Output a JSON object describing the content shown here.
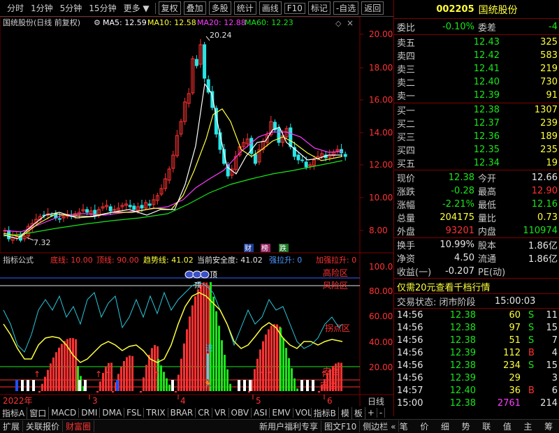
{
  "toolbar": {
    "items": [
      "分时",
      "1分钟",
      "5分钟",
      "15分钟",
      "更多"
    ],
    "buttons": [
      "复权",
      "叠加",
      "多股",
      "统计",
      "画线",
      "F10",
      "标记",
      "-自选",
      "返回"
    ]
  },
  "kline": {
    "title": "国统股份(日线 前复权)",
    "ma5": "MA5: 12.59",
    "ma10": "MA10: 12.58",
    "ma20": "MA20: 12.88",
    "ma60": "MA60: 12.23",
    "high_label": "20.24",
    "low_label": "7.32",
    "y_ticks": [
      "20.00",
      "18.00",
      "16.00",
      "14.00",
      "12.00",
      "10.00",
      "8.00"
    ],
    "badges": [
      "财",
      "榜",
      "跌"
    ]
  },
  "indicator": {
    "name": "指标公式",
    "line_bottom": "底线: 10.00",
    "line_top": "顶线: 90.00",
    "trend": "趋势线: 41.02",
    "safety": "当前安全度: 41.02",
    "strong": "强拉升: 0",
    "accel": "加强拉升: 0",
    "y_ticks": [
      "100.0",
      "80.00",
      "60.00",
      "40.00",
      "20.00"
    ],
    "labels": [
      "高险区",
      "风险区",
      "拐点区",
      "安全",
      "安区"
    ],
    "top_marker": "顶",
    "enter_marker": "进"
  },
  "x_axis": {
    "labels": [
      "2022年",
      "3",
      "4",
      "5",
      "6"
    ],
    "right": "日线"
  },
  "bottom_tabs": [
    "指标A",
    "窗口",
    "MACD",
    "DMI",
    "DMA",
    "FSL",
    "TRIX",
    "BRAR",
    "CR",
    "VR",
    "OBV",
    "ASI",
    "EMV",
    "VOL-TDX",
    "指标B",
    "模",
    "板",
    "+",
    "-"
  ],
  "statusbar": [
    "扩展",
    "关联报价",
    "财富圈",
    "新用户福利专享",
    "图文F10",
    "侧边栏"
  ],
  "quote": {
    "code": "002205",
    "name": "国统股份",
    "weibi": "-0.10%",
    "weicha": "-4",
    "asks": [
      {
        "label": "卖五",
        "price": "12.43",
        "vol": "325"
      },
      {
        "label": "卖四",
        "price": "12.42",
        "vol": "583"
      },
      {
        "label": "卖三",
        "price": "12.41",
        "vol": "219"
      },
      {
        "label": "卖二",
        "price": "12.40",
        "vol": "730"
      },
      {
        "label": "卖一",
        "price": "12.39",
        "vol": "91"
      }
    ],
    "bids": [
      {
        "label": "买一",
        "price": "12.38",
        "vol": "1307"
      },
      {
        "label": "买二",
        "price": "12.37",
        "vol": "239"
      },
      {
        "label": "买三",
        "price": "12.36",
        "vol": "189"
      },
      {
        "label": "买四",
        "price": "12.35",
        "vol": "235"
      },
      {
        "label": "买五",
        "price": "12.34",
        "vol": "19"
      }
    ],
    "stats": [
      {
        "l1": "现价",
        "v1": "12.38",
        "c1": "green",
        "l2": "今开",
        "v2": "12.66",
        "c2": "white"
      },
      {
        "l1": "涨跌",
        "v1": "-0.28",
        "c1": "green",
        "l2": "最高",
        "v2": "12.90",
        "c2": "red"
      },
      {
        "l1": "涨幅",
        "v1": "-2.21%",
        "c1": "green",
        "l2": "最低",
        "v2": "12.16",
        "c2": "green"
      },
      {
        "l1": "总量",
        "v1": "204175",
        "c1": "yellow",
        "l2": "量比",
        "v2": "0.73",
        "c2": "yellow"
      },
      {
        "l1": "外盘",
        "v1": "93201",
        "c1": "red",
        "l2": "内盘",
        "v2": "110974",
        "c2": "green"
      }
    ],
    "stats2": [
      {
        "l1": "换手",
        "v1": "10.99%",
        "l2": "股本",
        "v2": "1.86亿"
      },
      {
        "l1": "净资",
        "v1": "4.50",
        "l2": "流通",
        "v2": "1.86亿"
      },
      {
        "l1": "收益(一)",
        "v1": "-0.207",
        "l2": "PE(动)",
        "v2": ""
      }
    ],
    "promo": "仅需20元查看千档行情",
    "trade_status": "交易状态: 闭市阶段",
    "trade_time": "15:00:03",
    "ticks": [
      {
        "t": "14:56",
        "p": "12.38",
        "pc": "green",
        "v": "60",
        "vc": "yellow",
        "bs": "S",
        "bsc": "green",
        "n": "11"
      },
      {
        "t": "14:56",
        "p": "12.38",
        "pc": "green",
        "v": "97",
        "vc": "yellow",
        "bs": "S",
        "bsc": "green",
        "n": "15"
      },
      {
        "t": "14:56",
        "p": "12.38",
        "pc": "green",
        "v": "51",
        "vc": "yellow",
        "bs": "S",
        "bsc": "green",
        "n": "7"
      },
      {
        "t": "14:56",
        "p": "12.39",
        "pc": "green",
        "v": "112",
        "vc": "yellow",
        "bs": "B",
        "bsc": "red",
        "n": "4"
      },
      {
        "t": "14:56",
        "p": "12.38",
        "pc": "green",
        "v": "234",
        "vc": "yellow",
        "bs": "S",
        "bsc": "green",
        "n": "15"
      },
      {
        "t": "14:56",
        "p": "12.39",
        "pc": "green",
        "v": "29",
        "vc": "yellow",
        "bs": "",
        "bsc": "green",
        "n": "3"
      },
      {
        "t": "14:57",
        "p": "12.40",
        "pc": "green",
        "v": "36",
        "vc": "yellow",
        "bs": "B",
        "bsc": "red",
        "n": "6"
      },
      {
        "t": "15:00",
        "p": "12.38",
        "pc": "green",
        "v": "2761",
        "vc": "magenta",
        "bs": "",
        "bsc": "green",
        "n": "214"
      }
    ],
    "tabs": [
      "笔",
      "价",
      "细",
      "势",
      "联",
      "值",
      "主",
      "筹"
    ]
  }
}
